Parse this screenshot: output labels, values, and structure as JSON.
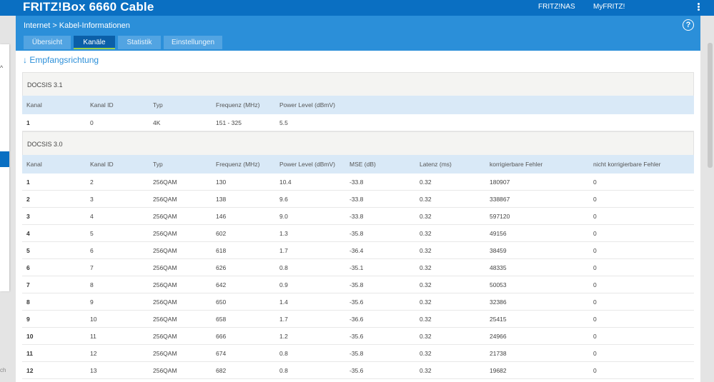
{
  "topbar": {
    "brand": "FRITZ!Box 6660 Cable",
    "links": [
      "FRITZ!NAS",
      "MyFRITZ!"
    ]
  },
  "sidebar": {
    "partial_text": "ch"
  },
  "header": {
    "breadcrumb": [
      "Internet",
      "Kabel-Informationen"
    ],
    "breadcrumb_sep": ">",
    "help": "?",
    "tabs": [
      "Übersicht",
      "Kanäle",
      "Statistik",
      "Einstellungen"
    ],
    "active_tab": "Kanäle"
  },
  "section": {
    "title": "↓ Empfangsrichtung"
  },
  "docsis31": {
    "title": "DOCSIS 3.1",
    "columns": [
      "Kanal",
      "Kanal ID",
      "Typ",
      "Frequenz (MHz)",
      "Power Level (dBmV)"
    ],
    "rows": [
      [
        "1",
        "0",
        "4K",
        "151 - 325",
        "5.5"
      ]
    ]
  },
  "docsis30": {
    "title": "DOCSIS 3.0",
    "columns": [
      "Kanal",
      "Kanal ID",
      "Typ",
      "Frequenz (MHz)",
      "Power Level (dBmV)",
      "MSE (dB)",
      "Latenz (ms)",
      "korrigierbare Fehler",
      "nicht korrigierbare Fehler"
    ],
    "rows": [
      [
        "1",
        "2",
        "256QAM",
        "130",
        "10.4",
        "-33.8",
        "0.32",
        "180907",
        "0"
      ],
      [
        "2",
        "3",
        "256QAM",
        "138",
        "9.6",
        "-33.8",
        "0.32",
        "338867",
        "0"
      ],
      [
        "3",
        "4",
        "256QAM",
        "146",
        "9.0",
        "-33.8",
        "0.32",
        "597120",
        "0"
      ],
      [
        "4",
        "5",
        "256QAM",
        "602",
        "1.3",
        "-35.8",
        "0.32",
        "49156",
        "0"
      ],
      [
        "5",
        "6",
        "256QAM",
        "618",
        "1.7",
        "-36.4",
        "0.32",
        "38459",
        "0"
      ],
      [
        "6",
        "7",
        "256QAM",
        "626",
        "0.8",
        "-35.1",
        "0.32",
        "48335",
        "0"
      ],
      [
        "7",
        "8",
        "256QAM",
        "642",
        "0.9",
        "-35.8",
        "0.32",
        "50053",
        "0"
      ],
      [
        "8",
        "9",
        "256QAM",
        "650",
        "1.4",
        "-35.6",
        "0.32",
        "32386",
        "0"
      ],
      [
        "9",
        "10",
        "256QAM",
        "658",
        "1.7",
        "-36.6",
        "0.32",
        "25415",
        "0"
      ],
      [
        "10",
        "11",
        "256QAM",
        "666",
        "1.2",
        "-35.6",
        "0.32",
        "24966",
        "0"
      ],
      [
        "11",
        "12",
        "256QAM",
        "674",
        "0.8",
        "-35.8",
        "0.32",
        "21738",
        "0"
      ],
      [
        "12",
        "13",
        "256QAM",
        "682",
        "0.8",
        "-35.6",
        "0.32",
        "19682",
        "0"
      ]
    ]
  }
}
